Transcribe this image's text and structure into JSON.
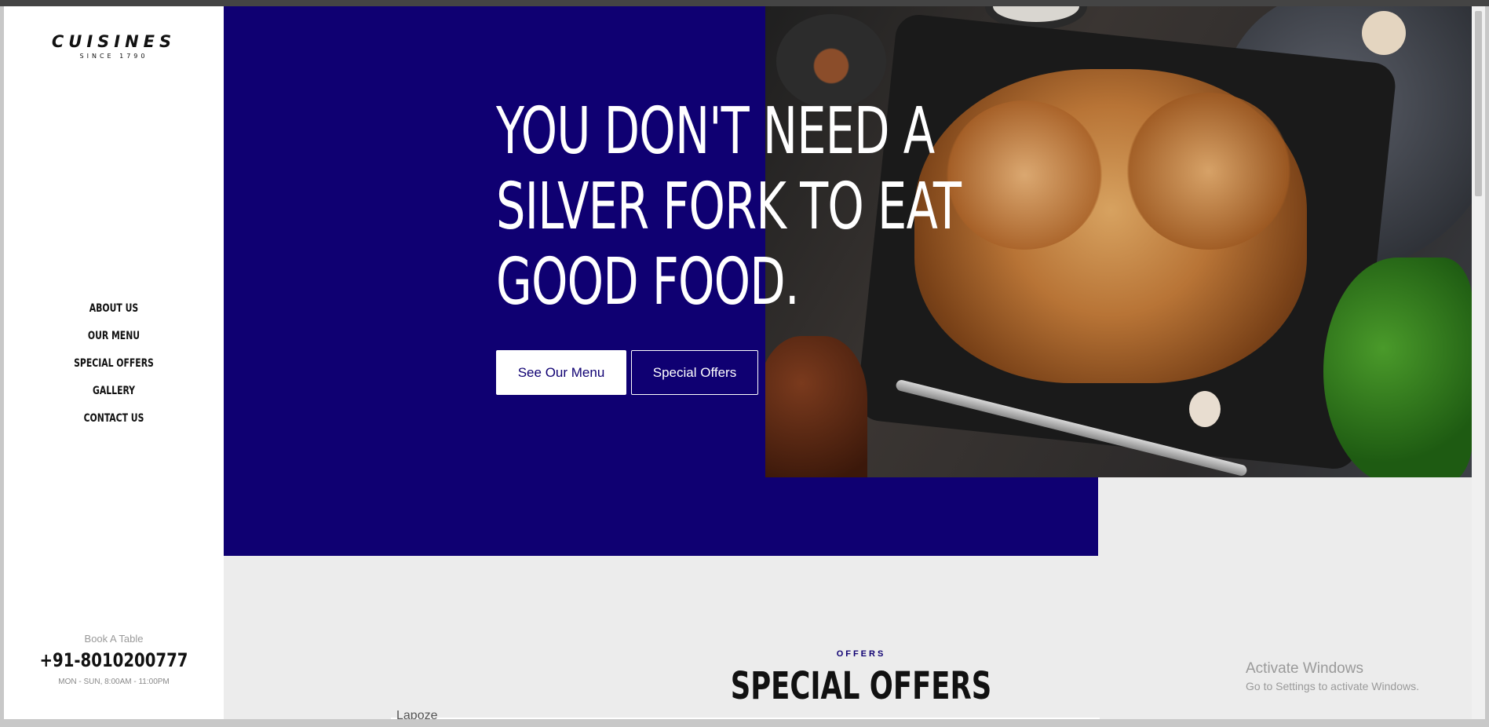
{
  "brand": {
    "name": "CUISINES",
    "tagline": "SINCE 1790"
  },
  "nav": {
    "items": [
      {
        "label": "ABOUT US"
      },
      {
        "label": "OUR MENU"
      },
      {
        "label": "SPECIAL OFFERS"
      },
      {
        "label": "GALLERY"
      },
      {
        "label": "CONTACT US"
      }
    ]
  },
  "booking": {
    "label": "Book A Table",
    "phone": "+91-8010200777",
    "hours": "MON - SUN, 8:00AM - 11:00PM"
  },
  "hero": {
    "line1": "YOU DON'T NEED A",
    "line2": "SILVER FORK TO EAT",
    "line3": "GOOD FOOD.",
    "primary_button": "See Our Menu",
    "secondary_button": "Special Offers",
    "background_color": "#0f0072"
  },
  "offers": {
    "kicker": "OFFERS",
    "title": "SPECIAL OFFERS"
  },
  "partial_text": "Lapoze",
  "os_watermark": {
    "title": "Activate Windows",
    "subtitle": "Go to Settings to activate Windows."
  }
}
